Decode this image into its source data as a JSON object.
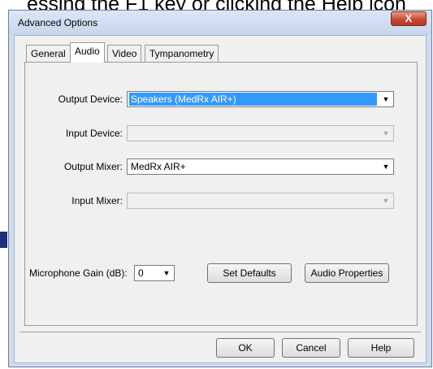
{
  "backdrop": {
    "text": "essing the F1 key or clicking the Help icon"
  },
  "window": {
    "title": "Advanced Options",
    "close_label": "X"
  },
  "tabs": [
    {
      "label": "General",
      "active": false
    },
    {
      "label": "Audio",
      "active": true
    },
    {
      "label": "Video",
      "active": false
    },
    {
      "label": "Tympanometry",
      "active": false
    }
  ],
  "audio": {
    "output_device": {
      "label": "Output Device:",
      "value": "Speakers (MedRx AIR+)"
    },
    "input_device": {
      "label": "Input Device:",
      "value": ""
    },
    "output_mixer": {
      "label": "Output Mixer:",
      "value": "MedRx AIR+"
    },
    "input_mixer": {
      "label": "Input Mixer:",
      "value": ""
    },
    "mic_gain": {
      "label": "Microphone Gain (dB):",
      "value": "0"
    },
    "set_defaults_label": "Set Defaults",
    "audio_properties_label": "Audio Properties"
  },
  "footer": {
    "ok_label": "OK",
    "cancel_label": "Cancel",
    "help_label": "Help"
  },
  "icons": {
    "dropdown": "chevron-down-icon",
    "close": "close-icon"
  }
}
